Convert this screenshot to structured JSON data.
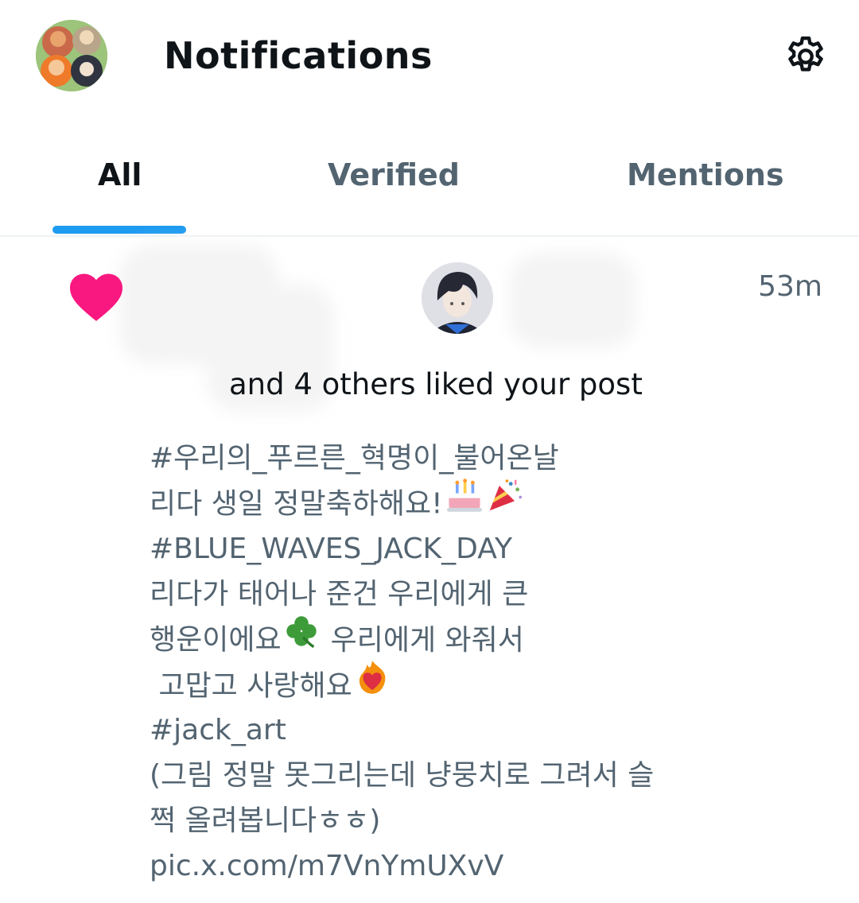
{
  "header": {
    "title": "Notifications",
    "avatar_icon": "group-avatar-icon",
    "settings_icon": "gear-icon"
  },
  "tabs": [
    {
      "label": "All",
      "active": true
    },
    {
      "label": "Verified",
      "active": false
    },
    {
      "label": "Mentions",
      "active": false
    }
  ],
  "notification": {
    "type_icon": "heart-icon",
    "type_color": "#f91880",
    "time": "53m",
    "summary": "and 4 others liked your post",
    "post_lines": [
      "#우리의_푸르른_혁명이_불어온날",
      "리다 생일 정말축하해요!",
      "#BLUE_WAVES_JACK_DAY",
      "리다가 태어나 준건 우리에게 큰",
      "행운이에요",
      "우리에게 와줘서",
      " 고맙고 사랑해요",
      "#jack_art",
      "(그림 정말 못그리는데 냥뭉치로 그려서 슬",
      "쩍 올려봅니다ㅎㅎ)",
      "pic.x.com/m7VnYmUXvV"
    ],
    "emojis": [
      "cake-icon",
      "party-popper-icon",
      "clover-icon",
      "heart-on-fire-icon"
    ]
  },
  "colors": {
    "accent": "#1d9bf0",
    "like": "#f91880",
    "text_primary": "#0f1419",
    "text_secondary": "#536471"
  }
}
